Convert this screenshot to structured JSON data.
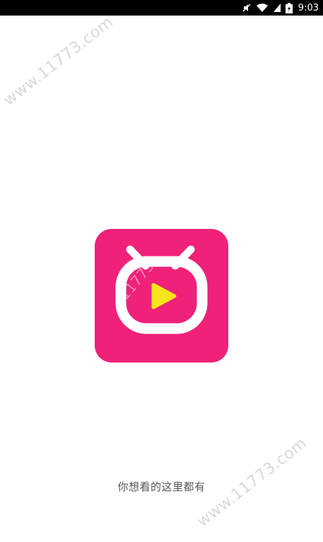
{
  "status_bar": {
    "time": "9:03",
    "icons": [
      "mute-icon",
      "wifi-icon",
      "signal-icon",
      "battery-charging-icon"
    ]
  },
  "watermark": {
    "top": "www.11773.com",
    "bottom": "www.11773.com",
    "logo": "11773"
  },
  "splash": {
    "logo_name": "tv-play-icon",
    "slogan": "你想看的这里都有"
  },
  "colors": {
    "brand": "#ef2179",
    "play": "#f7e51c",
    "status_bar": "#000000"
  }
}
